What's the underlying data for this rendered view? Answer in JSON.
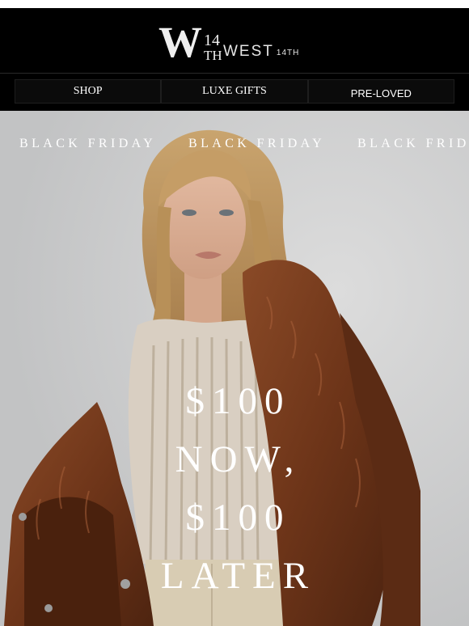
{
  "brand": {
    "logo_word": "WEST",
    "logo_sup": "14TH",
    "monogram_number": "14",
    "monogram_suffix": "TH"
  },
  "nav": {
    "items": [
      {
        "label": "SHOP"
      },
      {
        "label": "LUXE GIFTS"
      },
      {
        "label": "PRE-LOVED"
      }
    ]
  },
  "hero": {
    "ticker": [
      "BLACK FRIDAY",
      "BLACK FRIDAY",
      "BLACK FRID"
    ],
    "headline": [
      "$100",
      "NOW,",
      "$100",
      "LATER"
    ]
  },
  "colors": {
    "header_bg": "#000000",
    "nav_text": "#ffffff",
    "headline_text": "#ffffff",
    "fur": "#7b3f20"
  }
}
